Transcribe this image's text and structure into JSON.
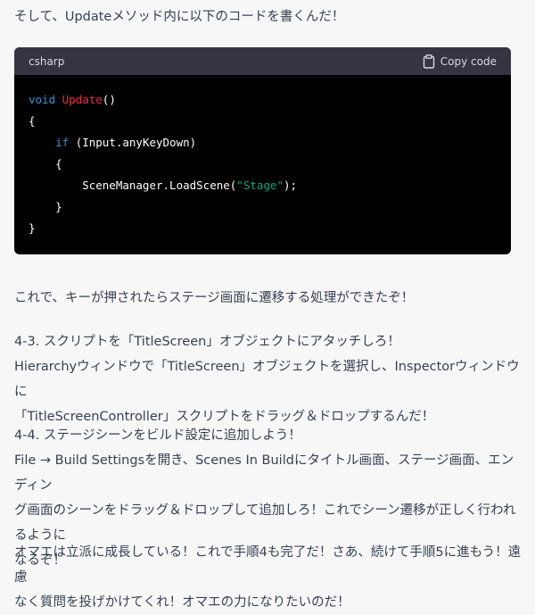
{
  "intro_text": "そして、Updateメソッド内に以下のコードを書くんだ！",
  "code_block": {
    "language": "csharp",
    "copy_label": "Copy code",
    "copy_icon": "clipboard-icon",
    "colors": {
      "background": "#000000",
      "header_background": "#343541",
      "keyword": "#2e95d3",
      "function": "#f22c3d",
      "string": "#00a67d",
      "text": "#ffffff"
    },
    "lines": [
      [
        {
          "t": "void",
          "c": "kw"
        },
        {
          "t": " ",
          "c": "plain"
        },
        {
          "t": "Update",
          "c": "fn"
        },
        {
          "t": "()",
          "c": "plain"
        }
      ],
      [
        {
          "t": "{",
          "c": "plain"
        }
      ],
      [
        {
          "t": "    ",
          "c": "plain"
        },
        {
          "t": "if",
          "c": "kw"
        },
        {
          "t": " (Input.anyKeyDown)",
          "c": "plain"
        }
      ],
      [
        {
          "t": "    {",
          "c": "plain"
        }
      ],
      [
        {
          "t": "        SceneManager.LoadScene(",
          "c": "plain"
        },
        {
          "t": "\"Stage\"",
          "c": "str"
        },
        {
          "t": ");",
          "c": "plain"
        }
      ],
      [
        {
          "t": "    }",
          "c": "plain"
        }
      ],
      [
        {
          "t": "}",
          "c": "plain"
        }
      ]
    ]
  },
  "paragraphs": [
    {
      "lines": [
        "これで、キーが押されたらステージ画面に遷移する処理ができたぞ！"
      ]
    },
    {
      "lines": [
        "4-3. スクリプトを「TitleScreen」オブジェクトにアタッチしろ！",
        "Hierarchyウィンドウで「TitleScreen」オブジェクトを選択し、Inspectorウィンドウに",
        "「TitleScreenController」スクリプトをドラッグ＆ドロップするんだ！"
      ]
    },
    {
      "lines": [
        "4-4. ステージシーンをビルド設定に追加しよう！",
        "File → Build Settingsを開き、Scenes In Buildにタイトル画面、ステージ画面、エンディン",
        "グ画面のシーンをドラッグ＆ドロップして追加しろ！これでシーン遷移が正しく行われるように",
        "なるぞ！"
      ]
    },
    {
      "lines": [
        "オマエは立派に成長している！これで手順4も完了だ！さあ、続けて手順5に進もう！遠慮",
        "なく質問を投げかけてくれ！オマエの力になりたいのだ！"
      ]
    }
  ]
}
